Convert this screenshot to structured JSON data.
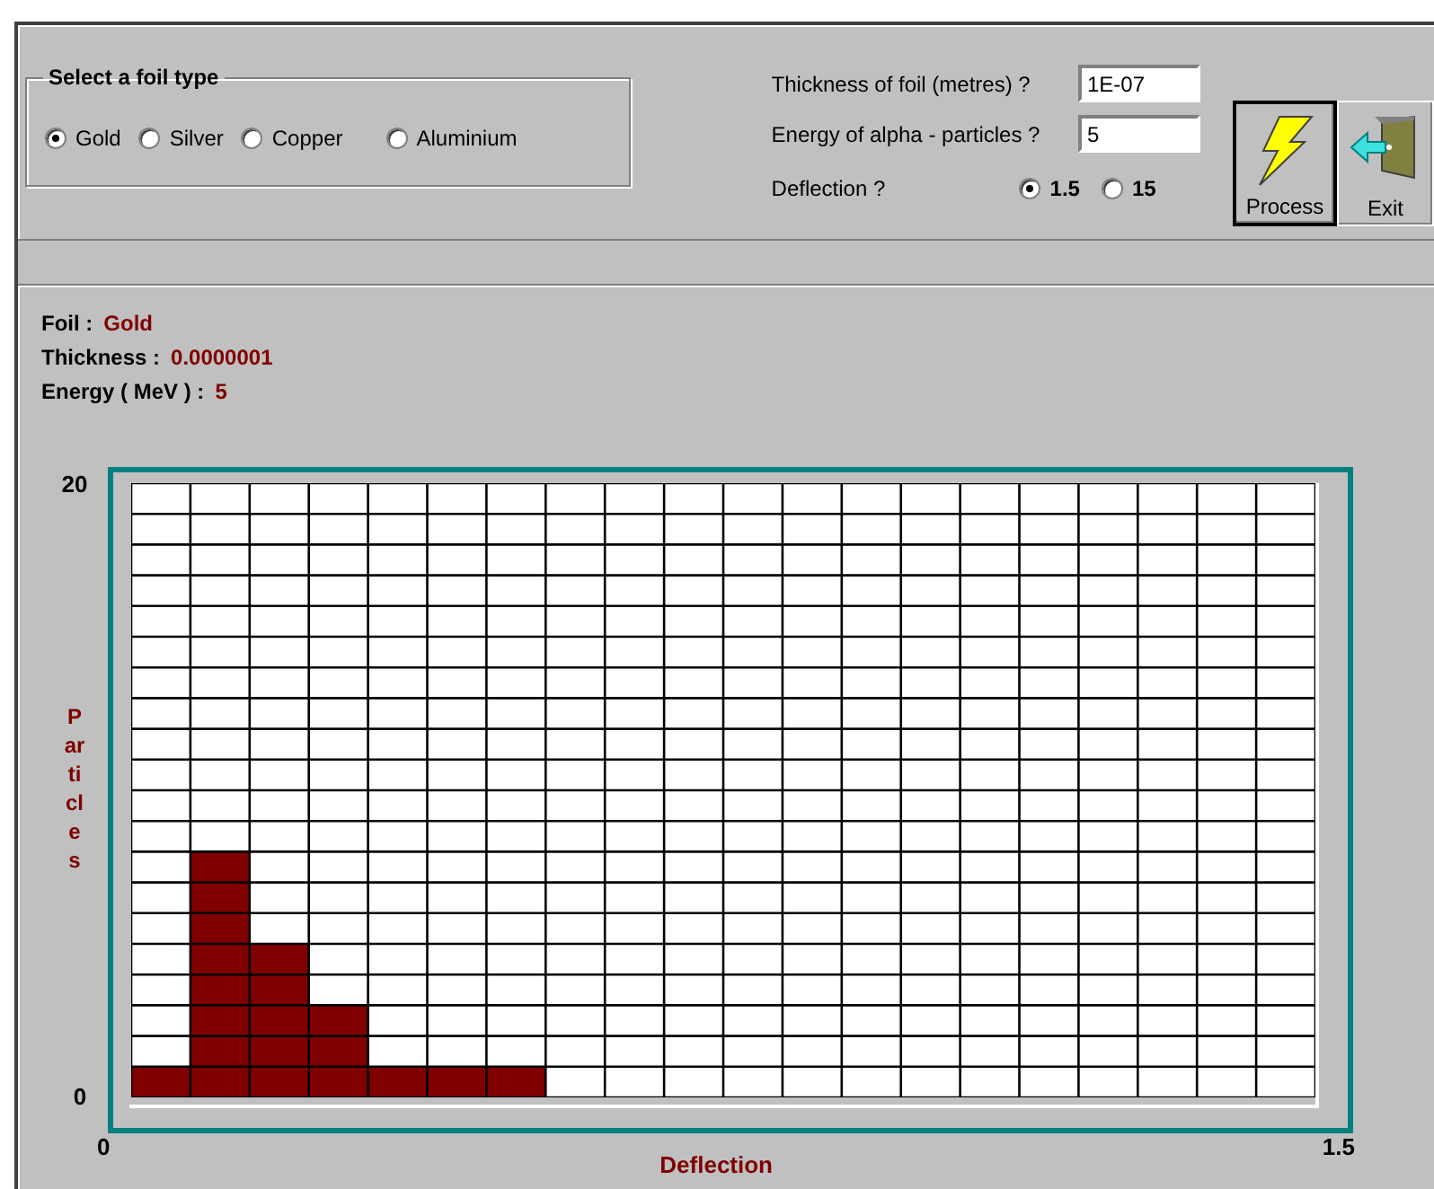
{
  "foil_group": {
    "title": "Select a foil type",
    "options": [
      {
        "label": "Gold",
        "selected": true
      },
      {
        "label": "Silver",
        "selected": false
      },
      {
        "label": "Copper",
        "selected": false
      },
      {
        "label": "Aluminium",
        "selected": false
      }
    ]
  },
  "fields": [
    {
      "label": "Thickness of foil (metres) ?",
      "value": "1E-07"
    },
    {
      "label": "Energy of alpha - particles ?",
      "value": "5"
    }
  ],
  "deflection": {
    "label": "Deflection ?",
    "options": [
      {
        "label": "1.5",
        "selected": true
      },
      {
        "label": "15",
        "selected": false
      }
    ]
  },
  "buttons": [
    {
      "kind": "process",
      "label": "Process"
    },
    {
      "kind": "exit",
      "label": "Exit"
    }
  ],
  "summary": [
    {
      "label": "Foil :",
      "value": "Gold"
    },
    {
      "label": "Thickness :",
      "value": "0.0000001"
    },
    {
      "label": "Energy ( MeV ) :",
      "value": "5"
    }
  ],
  "chart": {
    "x_start_label": "0",
    "x_end_label": "1.5",
    "chart_data": {
      "type": "bar",
      "xlabel": "Deflection",
      "ylabel": "Particles",
      "ylim": [
        0,
        20
      ],
      "yticks": [
        0,
        20
      ],
      "values": [
        1,
        8,
        5,
        3,
        1,
        1,
        1,
        0,
        0,
        0,
        0,
        0,
        0,
        0,
        0,
        0,
        0,
        0,
        0,
        0
      ]
    }
  }
}
